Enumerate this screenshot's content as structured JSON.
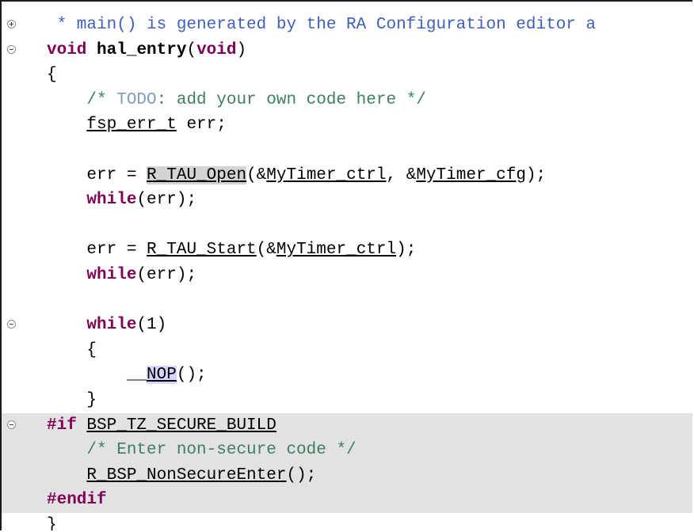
{
  "editor": {
    "lines": [
      {
        "fold": "expand",
        "inactive": false,
        "parts": [
          {
            "cls": "cm-doc",
            "t": " * main() is generated by the RA Configuration editor a"
          }
        ]
      },
      {
        "fold": "collapse",
        "inactive": false,
        "parts": [
          {
            "cls": "kw",
            "t": "void"
          },
          {
            "cls": "tx",
            "t": " "
          },
          {
            "cls": "fn",
            "t": "hal_entry"
          },
          {
            "cls": "tx",
            "t": "("
          },
          {
            "cls": "kw",
            "t": "void"
          },
          {
            "cls": "tx",
            "t": ")"
          }
        ]
      },
      {
        "fold": "",
        "inactive": false,
        "parts": [
          {
            "cls": "tx",
            "t": "{"
          }
        ]
      },
      {
        "fold": "",
        "inactive": false,
        "parts": [
          {
            "cls": "cm",
            "t": "    /* "
          },
          {
            "cls": "todo",
            "t": "TODO"
          },
          {
            "cls": "cm",
            "t": ": add your own code here */"
          }
        ]
      },
      {
        "fold": "",
        "inactive": false,
        "parts": [
          {
            "cls": "tx",
            "t": "    "
          },
          {
            "cls": "tx uline",
            "t": "fsp_err_t"
          },
          {
            "cls": "tx",
            "t": " err;"
          }
        ]
      },
      {
        "fold": "",
        "inactive": false,
        "parts": [
          {
            "cls": "tx",
            "t": ""
          }
        ]
      },
      {
        "fold": "",
        "inactive": false,
        "parts": [
          {
            "cls": "tx",
            "t": "    err = "
          },
          {
            "cls": "tx uline mark-grey",
            "t": "R_TAU_Open"
          },
          {
            "cls": "tx",
            "t": "(&"
          },
          {
            "cls": "tx uline",
            "t": "MyTimer_ctrl"
          },
          {
            "cls": "tx",
            "t": ", &"
          },
          {
            "cls": "tx uline",
            "t": "MyTimer_cfg"
          },
          {
            "cls": "tx",
            "t": ");"
          }
        ]
      },
      {
        "fold": "",
        "inactive": false,
        "parts": [
          {
            "cls": "tx",
            "t": "    "
          },
          {
            "cls": "kw",
            "t": "while"
          },
          {
            "cls": "tx",
            "t": "(err);"
          }
        ]
      },
      {
        "fold": "",
        "inactive": false,
        "parts": [
          {
            "cls": "tx",
            "t": ""
          }
        ]
      },
      {
        "fold": "",
        "inactive": false,
        "parts": [
          {
            "cls": "tx",
            "t": "    err = "
          },
          {
            "cls": "tx uline",
            "t": "R_TAU_Start"
          },
          {
            "cls": "tx",
            "t": "(&"
          },
          {
            "cls": "tx uline",
            "t": "MyTimer_ctrl"
          },
          {
            "cls": "tx",
            "t": ");"
          }
        ]
      },
      {
        "fold": "",
        "inactive": false,
        "parts": [
          {
            "cls": "tx",
            "t": "    "
          },
          {
            "cls": "kw",
            "t": "while"
          },
          {
            "cls": "tx",
            "t": "(err);"
          }
        ]
      },
      {
        "fold": "",
        "inactive": false,
        "parts": [
          {
            "cls": "tx",
            "t": ""
          }
        ]
      },
      {
        "fold": "collapse",
        "inactive": false,
        "parts": [
          {
            "cls": "tx",
            "t": "    "
          },
          {
            "cls": "kw",
            "t": "while"
          },
          {
            "cls": "tx",
            "t": "(1)"
          }
        ]
      },
      {
        "fold": "",
        "inactive": false,
        "parts": [
          {
            "cls": "tx",
            "t": "    {"
          }
        ]
      },
      {
        "fold": "",
        "inactive": false,
        "parts": [
          {
            "cls": "tx",
            "t": "        __"
          },
          {
            "cls": "tx uline mark-purple",
            "t": "NOP"
          },
          {
            "cls": "tx",
            "t": "();"
          }
        ]
      },
      {
        "fold": "",
        "inactive": false,
        "parts": [
          {
            "cls": "tx",
            "t": "    }"
          }
        ]
      },
      {
        "fold": "collapse",
        "inactive": true,
        "parts": [
          {
            "cls": "kw",
            "t": "#if"
          },
          {
            "cls": "tx",
            "t": " "
          },
          {
            "cls": "tx uline",
            "t": "BSP_TZ_SECURE_BUILD"
          }
        ]
      },
      {
        "fold": "",
        "inactive": true,
        "parts": [
          {
            "cls": "cm",
            "t": "    /* Enter non-secure code */"
          }
        ]
      },
      {
        "fold": "",
        "inactive": true,
        "parts": [
          {
            "cls": "tx",
            "t": "    "
          },
          {
            "cls": "tx uline",
            "t": "R_BSP_NonSecureEnter"
          },
          {
            "cls": "tx",
            "t": "();"
          }
        ]
      },
      {
        "fold": "",
        "inactive": true,
        "parts": [
          {
            "cls": "kw",
            "t": "#endif"
          }
        ]
      },
      {
        "fold": "",
        "inactive": false,
        "parts": [
          {
            "cls": "tx",
            "t": "}"
          }
        ]
      }
    ]
  }
}
